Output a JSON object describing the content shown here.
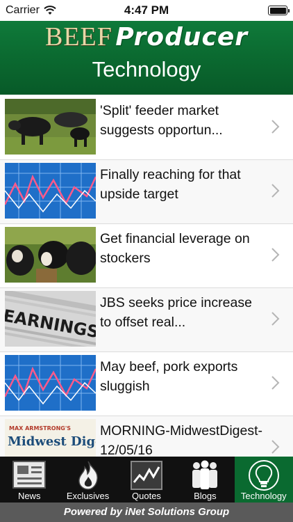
{
  "status_bar": {
    "carrier": "Carrier",
    "time": "4:47 PM",
    "icons": [
      "wifi-icon",
      "battery-icon"
    ]
  },
  "header": {
    "logo_part1": "BEEF",
    "logo_part2": "Producer",
    "section_title": "Technology",
    "colors": {
      "header_green": "#0b6b31",
      "logo_gold": "#e8d7a8"
    }
  },
  "articles": [
    {
      "title": "'Split' feeder market suggests opportun...",
      "thumbnail": "cattle-in-pasture"
    },
    {
      "title": "Finally reaching for that upside target",
      "thumbnail": "stock-chart"
    },
    {
      "title": "Get financial leverage on stockers",
      "thumbnail": "cattle-feeding"
    },
    {
      "title": "JBS seeks price increase to offset real...",
      "thumbnail": "earnings-newspaper"
    },
    {
      "title": "May beef, pork exports sluggish",
      "thumbnail": "stock-chart"
    },
    {
      "title": "MORNING-MidwestDigest-12/05/16",
      "thumbnail": "midwest-digest-logo",
      "thumb_text_top": "MAX ARMSTRONG'S",
      "thumb_text_main": "Midwest Digest"
    }
  ],
  "thumb_text": {
    "earnings": "EARNINGS"
  },
  "tabs": [
    {
      "label": "News",
      "icon": "newspaper-icon",
      "active": false
    },
    {
      "label": "Exclusives",
      "icon": "fire-icon",
      "active": false
    },
    {
      "label": "Quotes",
      "icon": "chart-line-icon",
      "active": false
    },
    {
      "label": "Blogs",
      "icon": "people-icon",
      "active": false
    },
    {
      "label": "Technology",
      "icon": "lightbulb-icon",
      "active": true
    }
  ],
  "footer": {
    "text": "Powered by iNet Solutions Group"
  }
}
